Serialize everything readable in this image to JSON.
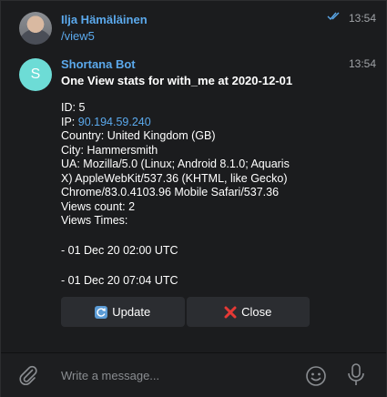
{
  "colors": {
    "background": "#1b1c1e",
    "link": "#5ba9ec",
    "bot_avatar": "#6ddcd6",
    "button_bg": "#2b2d31"
  },
  "user_message": {
    "sender": "Ilja Hämäläinen",
    "text": "/view5",
    "time": "13:54",
    "status_icon": "double-check-icon"
  },
  "bot_message": {
    "sender": "Shortana Bot",
    "avatar_letter": "S",
    "time": "13:54",
    "title": "One View stats for with_me at 2020-12-01",
    "id_line": "ID: 5",
    "ip_label": "IP: ",
    "ip_value": "90.194.59.240",
    "country": "Country: United Kingdom (GB)",
    "city": "City: Hammersmith",
    "ua_1": "UA: Mozilla/5.0 (Linux; Android 8.1.0; Aquaris",
    "ua_2": "X) AppleWebKit/537.36 (KHTML, like Gecko)",
    "ua_3": "Chrome/83.0.4103.96 Mobile Safari/537.36",
    "views_count": "Views count: 2",
    "views_times": "Views Times:",
    "time_1": " - 01 Dec 20 02:00 UTC",
    "time_2": " - 01 Dec 20 07:04 UTC",
    "buttons": [
      {
        "label": "Update",
        "icon": "refresh-icon"
      },
      {
        "label": "Close",
        "icon": "cross-icon"
      }
    ]
  },
  "composer": {
    "placeholder": "Write a message...",
    "icons": [
      "paperclip-icon",
      "emoji-icon",
      "microphone-icon"
    ]
  }
}
